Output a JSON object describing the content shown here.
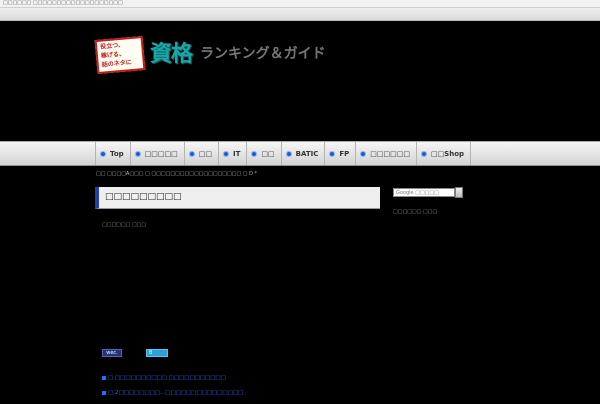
{
  "top_strip": {
    "text": "□□□□□□ □□□□□□□□□□□□□□□□□□□"
  },
  "logo": {
    "badge_lines": [
      "役立つ、",
      "稼げる、",
      "話のネタに"
    ],
    "main": "資格",
    "sub": "ランキング＆ガイド"
  },
  "nav": {
    "items": [
      {
        "label": "Top"
      },
      {
        "label": "□□□□□"
      },
      {
        "label": "□□"
      },
      {
        "label": "IT"
      },
      {
        "label": "□□"
      },
      {
        "label": "BATIC"
      },
      {
        "label": "FP"
      },
      {
        "label": "□□□□□□"
      },
      {
        "label": "□□Shop"
      }
    ]
  },
  "breadcrumb": "□□ □□□□A□□□ □ □□□□□□□□□□□□□□□□□□□ □ D *",
  "page_title": "□□□□□□□□□",
  "content_text": "□□□□□□ □□□",
  "search": {
    "placeholder": "Google □□□□□"
  },
  "sidebar_text": "□□□□□□ □□□",
  "share": {
    "button1": "wec.",
    "button2": "B"
  },
  "links": [
    {
      "label": "□ □□□□□□□□□□ □□□□□□□□□□□"
    },
    {
      "label": "□ 2□□□□□□□□...□□□□□□□□□□□□□□□"
    }
  ],
  "colors": {
    "accent": "#1f3fae",
    "logo_teal": "#1aa6a6",
    "link": "#2a6bff"
  }
}
